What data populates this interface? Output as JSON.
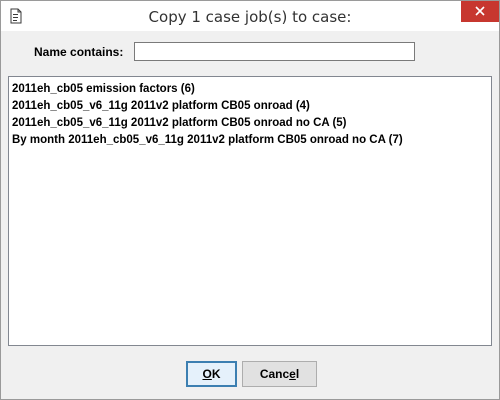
{
  "window": {
    "title": "Copy 1 case job(s) to case:",
    "title_icon": "document-icon",
    "close_icon": "close-icon"
  },
  "filter": {
    "label": "Name contains:",
    "value": ""
  },
  "case_list": {
    "items": [
      "2011eh_cb05 emission factors  (6)",
      "2011eh_cb05_v6_11g 2011v2 platform CB05 onroad  (4)",
      "2011eh_cb05_v6_11g 2011v2 platform CB05 onroad no CA  (5)",
      "By month 2011eh_cb05_v6_11g 2011v2 platform CB05 onroad no CA  (7)"
    ]
  },
  "buttons": {
    "ok_mnemonic": "O",
    "ok_rest": "K",
    "cancel_before": "Canc",
    "cancel_mnemonic": "e",
    "cancel_after": "l"
  },
  "colors": {
    "close_button": "#c7372f",
    "default_button_border": "#3c7fb1"
  }
}
